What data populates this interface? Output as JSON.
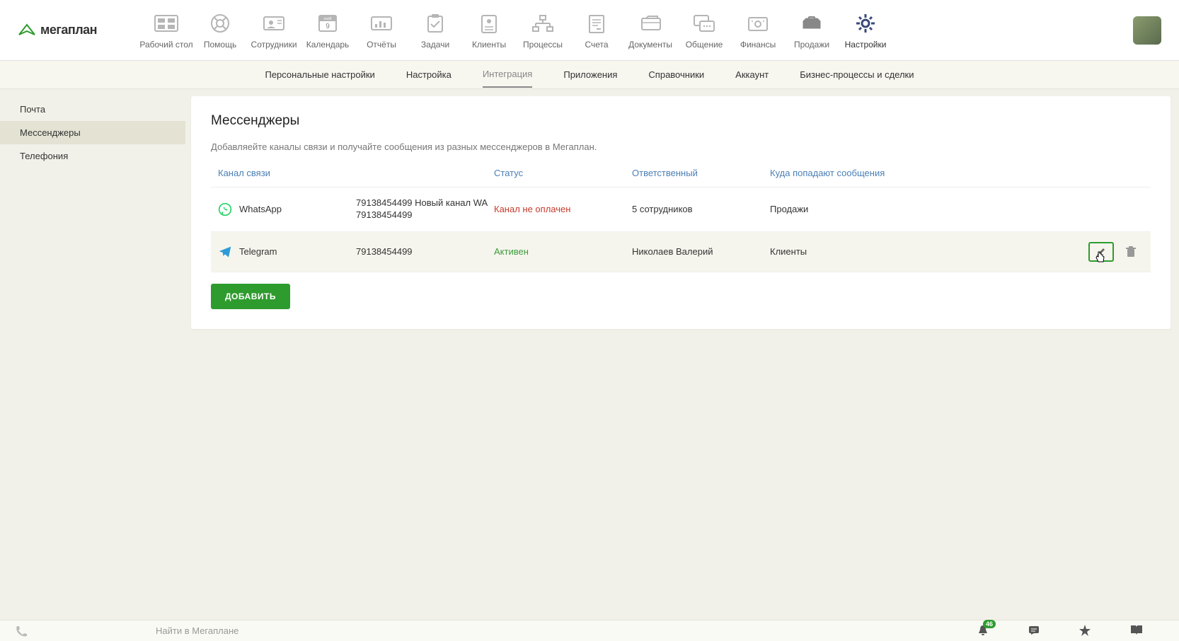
{
  "app": {
    "name": "мегаплан"
  },
  "topnav": [
    {
      "label": "Рабочий стол",
      "icon": "desktop"
    },
    {
      "label": "Помощь",
      "icon": "help"
    },
    {
      "label": "Сотрудники",
      "icon": "employees"
    },
    {
      "label": "Календарь",
      "icon": "calendar",
      "cal_top": "нояб",
      "cal_day": "9"
    },
    {
      "label": "Отчёты",
      "icon": "reports"
    },
    {
      "label": "Задачи",
      "icon": "tasks"
    },
    {
      "label": "Клиенты",
      "icon": "clients"
    },
    {
      "label": "Процессы",
      "icon": "processes"
    },
    {
      "label": "Счета",
      "icon": "invoices"
    },
    {
      "label": "Документы",
      "icon": "documents"
    },
    {
      "label": "Общение",
      "icon": "chat"
    },
    {
      "label": "Финансы",
      "icon": "finance"
    },
    {
      "label": "Продажи",
      "icon": "sales"
    },
    {
      "label": "Настройки",
      "icon": "settings"
    }
  ],
  "subnav": [
    {
      "label": "Персональные настройки"
    },
    {
      "label": "Настройка"
    },
    {
      "label": "Интеграция",
      "active": true
    },
    {
      "label": "Приложения"
    },
    {
      "label": "Справочники"
    },
    {
      "label": "Аккаунт"
    },
    {
      "label": "Бизнес-процессы и сделки"
    }
  ],
  "sidebar": [
    {
      "label": "Почта"
    },
    {
      "label": "Мессенджеры",
      "active": true
    },
    {
      "label": "Телефония"
    }
  ],
  "page": {
    "title": "Мессенджеры",
    "description": "Добавляейте каналы связи и получайте сообщения из разных мессенджеров в Мегаплан."
  },
  "table": {
    "headers": {
      "channel": "Канал связи",
      "status": "Статус",
      "responsible": "Ответственный",
      "destination": "Куда попадают сообщения"
    },
    "rows": [
      {
        "channel": "WhatsApp",
        "channel_icon": "whatsapp",
        "detail": "79138454499 Новый канал WA 79138454499",
        "status": "Канал не оплачен",
        "status_class": "status-unpaid",
        "responsible": "5 сотрудников",
        "destination": "Продажи"
      },
      {
        "channel": "Telegram",
        "channel_icon": "telegram",
        "detail": "79138454499",
        "status": "Активен",
        "status_class": "status-active",
        "responsible": "Николаев Валерий",
        "destination": "Клиенты",
        "hovered": true
      }
    ],
    "add_button": "ДОБАВИТЬ"
  },
  "bottombar": {
    "search_placeholder": "Найти в Мегаплане",
    "notification_count": "46"
  }
}
